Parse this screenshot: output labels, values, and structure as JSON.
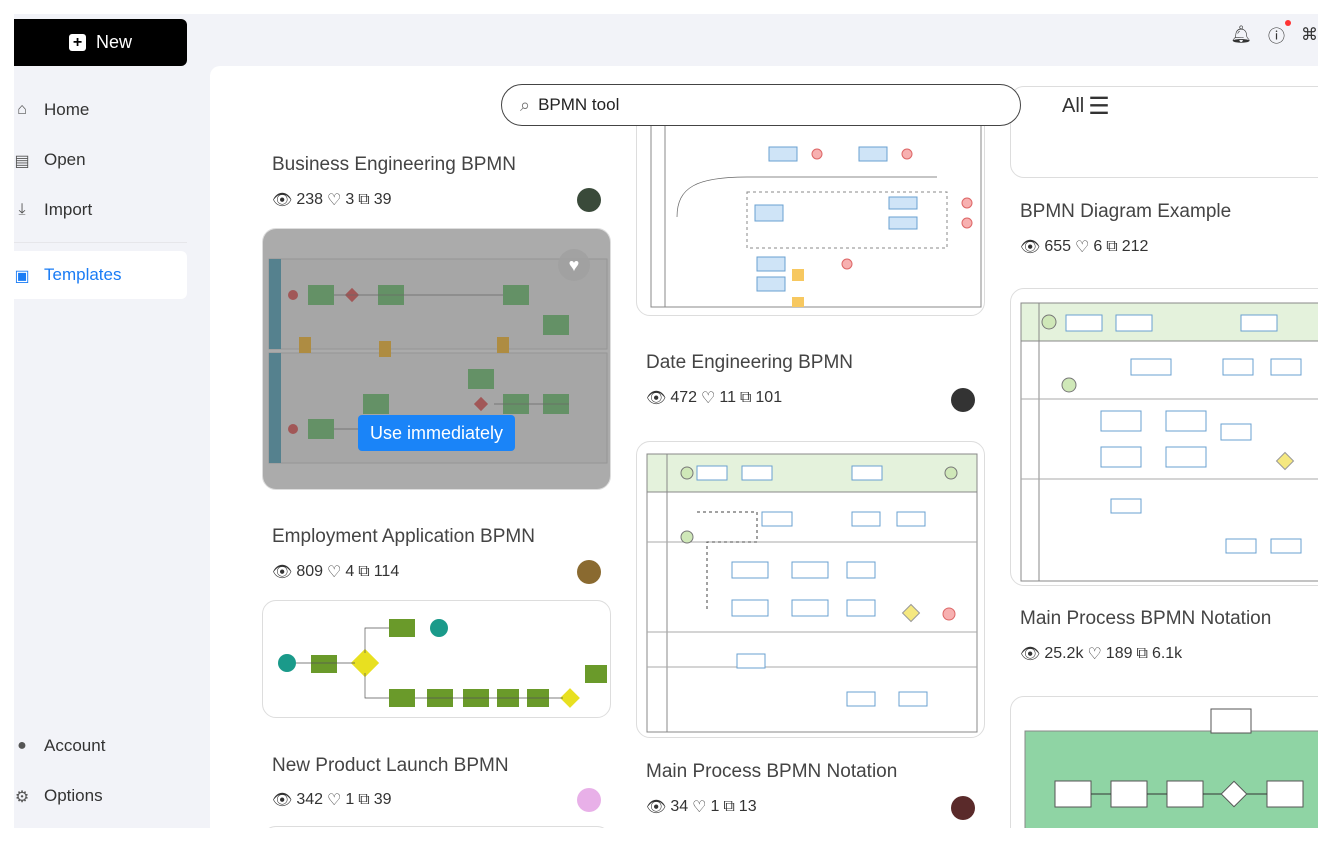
{
  "sidebar": {
    "new_label": "New",
    "items": [
      {
        "label": "Home",
        "icon": "home-icon"
      },
      {
        "label": "Open",
        "icon": "file-icon"
      },
      {
        "label": "Import",
        "icon": "import-icon"
      },
      {
        "label": "Templates",
        "icon": "templates-icon",
        "active": true
      }
    ],
    "bottom": [
      {
        "label": "Account",
        "icon": "account-icon"
      },
      {
        "label": "Options",
        "icon": "gear-icon"
      }
    ]
  },
  "topbar": {
    "icons": [
      "bell-icon",
      "help-icon",
      "apps-icon"
    ]
  },
  "search": {
    "value": "BPMN tool",
    "filter_label": "All"
  },
  "hover": {
    "use_label": "Use immediately"
  },
  "accent": "#1a84f8",
  "templates": [
    {
      "title": "Business Engineering BPMN",
      "views": "238",
      "likes": "3",
      "copies": "39"
    },
    {
      "title": "Employment Application BPMN",
      "views": "809",
      "likes": "4",
      "copies": "114"
    },
    {
      "title": "New Product Launch BPMN",
      "views": "342",
      "likes": "1",
      "copies": "39"
    },
    {
      "title": "Date Engineering BPMN",
      "views": "472",
      "likes": "11",
      "copies": "101"
    },
    {
      "title": "Main Process BPMN Notation",
      "views": "34",
      "likes": "1",
      "copies": "13"
    },
    {
      "title": "BPMN Diagram Example",
      "views": "655",
      "likes": "6",
      "copies": "212"
    },
    {
      "title": "Main Process BPMN Notation",
      "views": "25.2k",
      "likes": "189",
      "copies": "6.1k"
    }
  ]
}
